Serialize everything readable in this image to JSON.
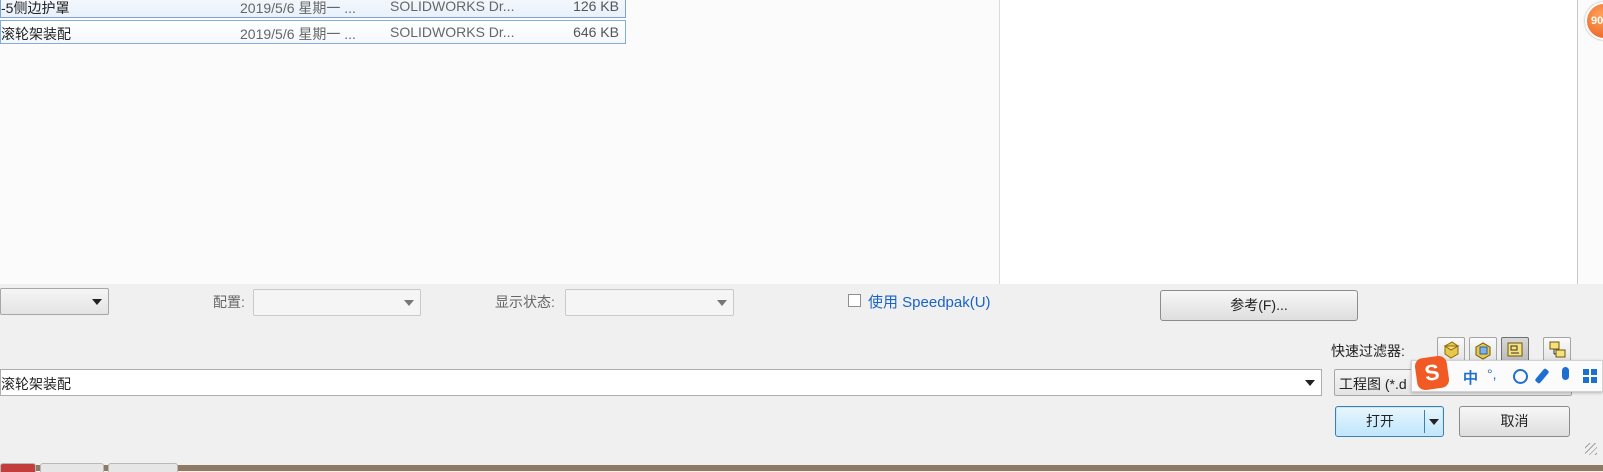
{
  "file_list": {
    "rows": [
      {
        "name": "-5侧边护罩",
        "date": "2019/5/6 星期一 ...",
        "type": "SOLIDWORKS Dr...",
        "size": "126 KB"
      },
      {
        "name": "滚轮架装配",
        "date": "2019/5/6 星期一 ...",
        "type": "SOLIDWORKS Dr...",
        "size": "646 KB"
      }
    ]
  },
  "options": {
    "config_label": "配置:",
    "display_state_label": "显示状态:",
    "speedpak_label": "使用 Speedpak(U)",
    "references_button": "参考(F)..."
  },
  "quick_filter": {
    "label": "快速过滤器:",
    "icons": [
      "part-filter-icon",
      "assembly-filter-icon",
      "drawing-filter-icon",
      "top-assembly-filter-icon"
    ]
  },
  "filename": {
    "value": "滚轮架装配"
  },
  "filetype": {
    "value": "工程图 (*.d"
  },
  "actions": {
    "open": "打开",
    "cancel": "取消"
  },
  "ime": {
    "chinese": "中",
    "punct": "°,",
    "logo": "S"
  },
  "badge": {
    "value": "90"
  },
  "colors": {
    "accent": "#3c7fb1",
    "link": "#1a62c8",
    "ime_orange": "#f15a24"
  }
}
